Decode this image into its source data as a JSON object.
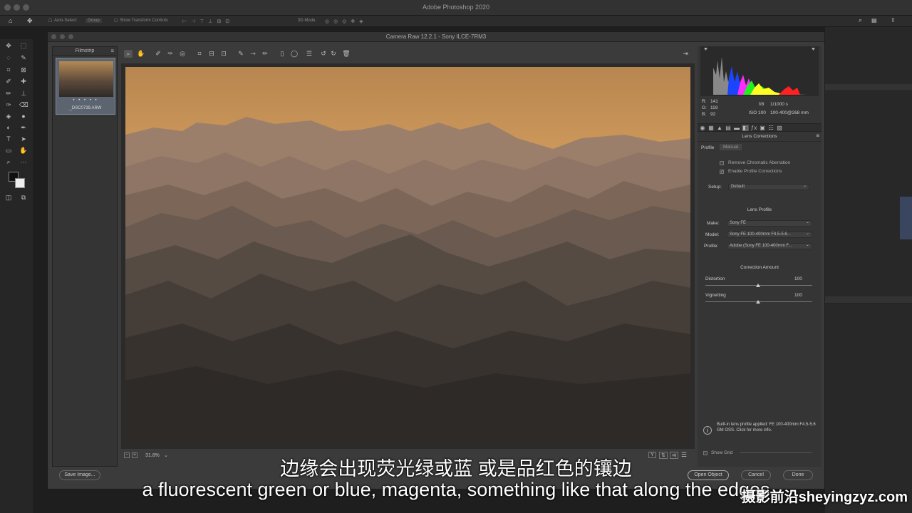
{
  "photoshop": {
    "title": "Adobe Photoshop 2020",
    "options": {
      "auto_select_label": "Auto-Select:",
      "auto_select_value": "Group",
      "transform_controls_label": "Show Transform Controls",
      "mode_label": "3D Mode:"
    }
  },
  "camera_raw": {
    "title": "Camera Raw 12.2.1  -  Sony ILCE-7RM3",
    "filmstrip": {
      "header": "Filmstrip",
      "stars": "• • • • •",
      "filename": "_DSC0739.ARW"
    },
    "zoom_level": "31.8%",
    "histogram": {
      "r": "141",
      "g": "119",
      "b": "92",
      "r_label": "R:",
      "g_label": "G:",
      "b_label": "B:",
      "aperture": "f/8",
      "shutter": "1/1000 s",
      "iso": "ISO 100",
      "lens": "100-400@268 mm"
    },
    "panel": {
      "title": "Lens Corrections",
      "tabs": [
        "Profile",
        "Manual"
      ],
      "remove_ca": "Remove Chromatic Aberration",
      "enable_profile": "Enable Profile Corrections",
      "setup_label": "Setup:",
      "setup_value": "Default",
      "lens_profile_heading": "Lens Profile",
      "make_label": "Make:",
      "make_value": "Sony FE",
      "model_label": "Model:",
      "model_value": "Sony FE 100-400mm F4.5-5.6...",
      "profile_label": "Profile:",
      "profile_value": "Adobe (Sony FE 100-400mm F...",
      "correction_heading": "Correction Amount",
      "distortion_label": "Distortion",
      "distortion_value": "100",
      "vignetting_label": "Vignetting",
      "vignetting_value": "100",
      "info_text": "Built-in lens profile applied: FE 100-400mm F4.5-5.6 GM OSS.  Click for more info.",
      "show_grid": "Show Grid"
    },
    "buttons": {
      "save_image": "Save Image...",
      "open_object": "Open Object",
      "cancel": "Cancel",
      "done": "Done"
    }
  },
  "subtitles": {
    "chinese": "边缘会出现荧光绿或蓝 或是品红色的镶边",
    "english": "a fluorescent green or blue, magenta, something like that along the edges"
  },
  "watermark": "摄影前沿sheyingzyz.com"
}
